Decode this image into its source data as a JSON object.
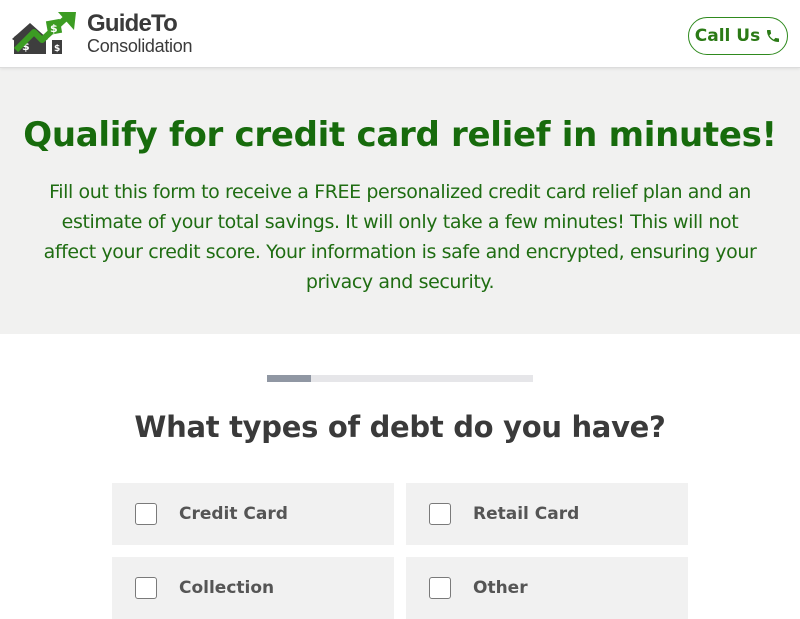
{
  "header": {
    "logo": {
      "line1": "GuideTo",
      "line2": "Consolidation"
    },
    "call_button": {
      "label": "Call Us",
      "icon": "phone-icon"
    }
  },
  "hero": {
    "title": "Qualify for credit card relief in minutes!",
    "description": "Fill out this form to receive a FREE personalized credit card relief plan and an estimate of your total savings. It will only take a few minutes! This will not affect your credit score. Your information is safe and encrypted, ensuring your privacy and security."
  },
  "form": {
    "progress_fraction": 0.165,
    "question": "What types of debt do you have?",
    "options": [
      {
        "label": "Credit Card",
        "checked": false
      },
      {
        "label": "Retail Card",
        "checked": false
      },
      {
        "label": "Collection",
        "checked": false
      },
      {
        "label": "Other",
        "checked": false
      }
    ]
  },
  "colors": {
    "brand_green": "#176b0c",
    "button_border": "#2f8a1e",
    "hero_bg": "#f1f1f0",
    "option_bg": "#f1f1f1",
    "progress_fill": "#9097a3",
    "progress_track": "#e6e6e9"
  }
}
